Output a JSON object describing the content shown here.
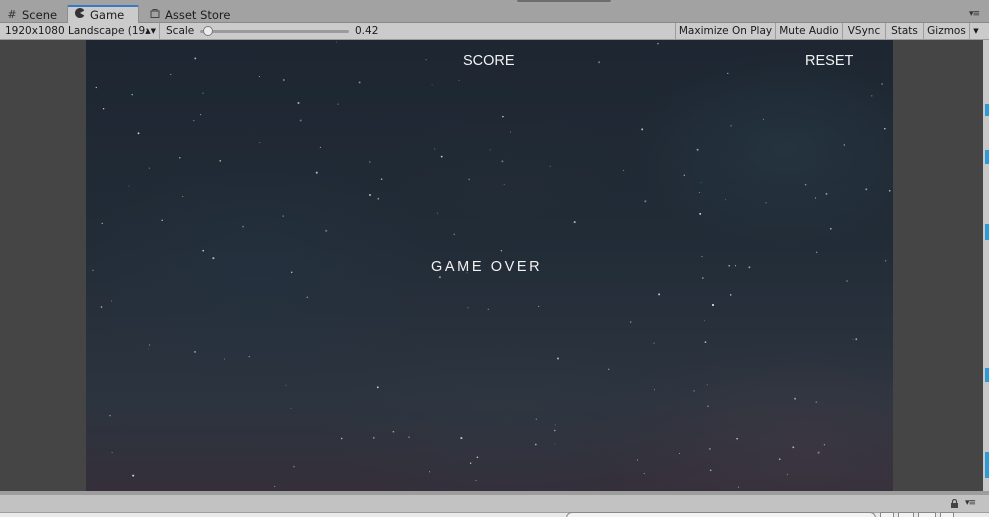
{
  "tabs": [
    {
      "label": "Scene",
      "icon": "hash-grid-icon"
    },
    {
      "label": "Game",
      "icon": "pacman-icon",
      "active": true
    },
    {
      "label": "Asset Store",
      "icon": "bag-icon"
    }
  ],
  "pane_menu_glyph": "▾≡",
  "toolbar": {
    "resolution": "1920x1080 Landscape (19:",
    "resolution_arrows": "▲▼",
    "scale_label": "Scale",
    "scale_value": "0.42",
    "scale_fraction": 0.02,
    "maximize_on_play": "Maximize On Play",
    "mute_audio": "Mute Audio",
    "vsync": "VSync",
    "stats": "Stats",
    "gizmos": "Gizmos",
    "gizmos_arrow": "▼"
  },
  "game": {
    "score_label": "SCORE",
    "reset_label": "RESET",
    "game_over_text": "GAME OVER",
    "background_colors": [
      "#1d2631",
      "#222c37",
      "#2c343f",
      "#352f3a"
    ]
  },
  "bottom_menu_glyph": "▾≡",
  "accent_color": "#3a78c6"
}
